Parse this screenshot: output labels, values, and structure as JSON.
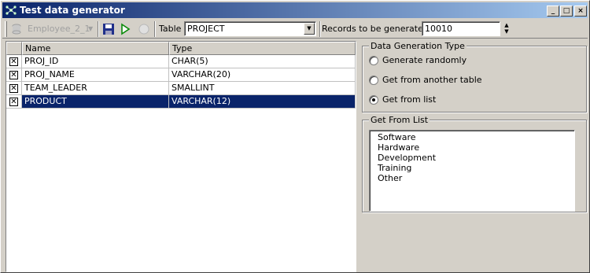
{
  "window": {
    "title": "Test data generator",
    "controls": {
      "minimize": "_",
      "maximize": "□",
      "close": "×"
    }
  },
  "toolbar": {
    "project_label": "Employee_2_1",
    "table_label": "Table",
    "table_value": "PROJECT",
    "records_label": "Records to be generated",
    "records_value": "10010"
  },
  "grid": {
    "columns": [
      "Name",
      "Type"
    ],
    "rows": [
      {
        "checked": "☒",
        "name": "PROJ_ID",
        "type": "CHAR(5)"
      },
      {
        "checked": "☒",
        "name": "PROJ_NAME",
        "type": "VARCHAR(20)"
      },
      {
        "checked": "☒",
        "name": "TEAM_LEADER",
        "type": "SMALLINT"
      },
      {
        "checked": "☒",
        "name": "PRODUCT",
        "type": "VARCHAR(12)"
      }
    ],
    "selected_row": 3
  },
  "generation_type": {
    "title": "Data Generation Type",
    "options": [
      {
        "label": "Generate randomly",
        "selected": false
      },
      {
        "label": "Get from another table",
        "selected": false
      },
      {
        "label": "Get from list",
        "selected": true
      }
    ]
  },
  "get_from_list": {
    "title": "Get From List",
    "items": [
      "Software",
      "Hardware",
      "Development",
      "Training",
      "Other"
    ]
  },
  "colors": {
    "selection": "#0a246a",
    "title_bar": "#0a246a",
    "face": "#d4d0c8"
  }
}
